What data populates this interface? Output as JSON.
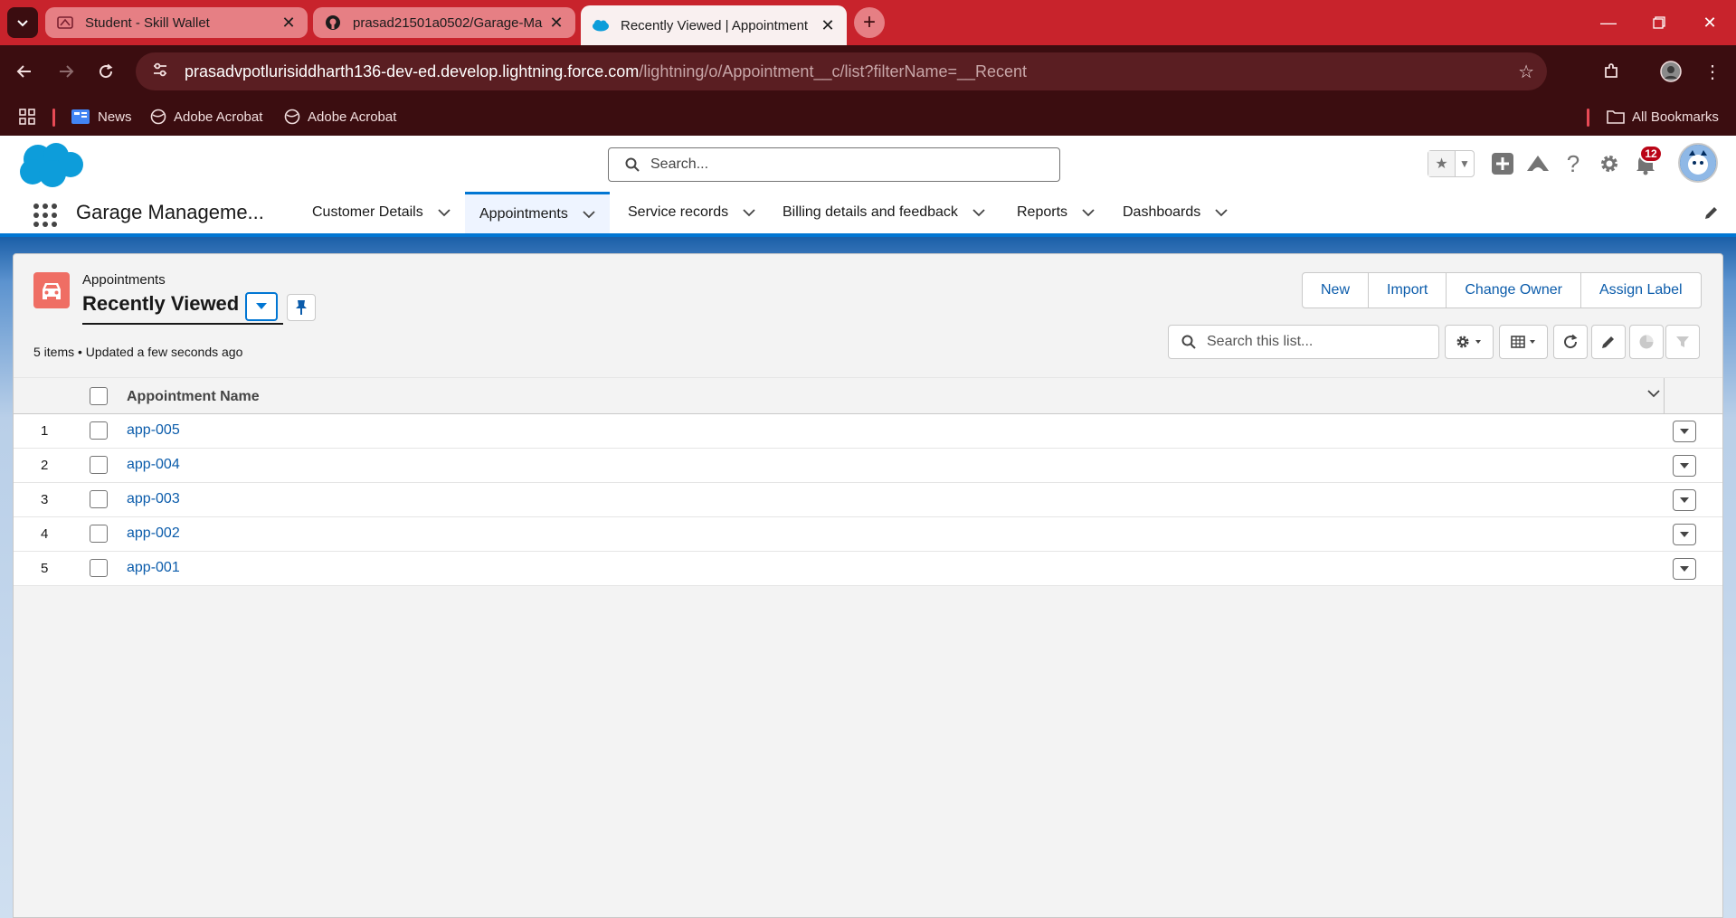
{
  "browser": {
    "tabs": [
      {
        "title": "Student - Skill Wallet",
        "icon": "skill-wallet-icon"
      },
      {
        "title": "prasad21501a0502/Garage-Ma",
        "icon": "github-icon"
      },
      {
        "title": "Recently Viewed | Appointment",
        "icon": "salesforce-cloud-icon",
        "active": true
      }
    ],
    "url_host": "prasadvpotlurisiddharth136-dev-ed.develop.lightning.force.com",
    "url_path": "/lightning/o/Appointment__c/list?filterName=__Recent",
    "bookmarks": [
      {
        "label": "News"
      },
      {
        "label": "Adobe Acrobat"
      },
      {
        "label": "Adobe Acrobat"
      }
    ],
    "all_bookmarks": "All Bookmarks",
    "colors": {
      "tab_strip": "#c8232c",
      "toolbar": "#3b0d10"
    }
  },
  "sf": {
    "search_placeholder": "Search...",
    "notifications_count": "12",
    "app_name": "Garage Manageme...",
    "nav": [
      {
        "label": "Customer Details"
      },
      {
        "label": "Appointments",
        "active": true
      },
      {
        "label": "Service records"
      },
      {
        "label": "Billing details and feedback"
      },
      {
        "label": "Reports"
      },
      {
        "label": "Dashboards"
      }
    ],
    "colors": {
      "brand": "#0176d3",
      "link": "#0b5cab",
      "object_icon": "#ef6e64"
    }
  },
  "list": {
    "object_label": "Appointments",
    "view_name": "Recently Viewed",
    "actions": [
      "New",
      "Import",
      "Change Owner",
      "Assign Label"
    ],
    "meta": "5 items • Updated a few seconds ago",
    "search_placeholder": "Search this list...",
    "column_header": "Appointment Name",
    "rows": [
      {
        "num": "1",
        "name": "app-005"
      },
      {
        "num": "2",
        "name": "app-004"
      },
      {
        "num": "3",
        "name": "app-003"
      },
      {
        "num": "4",
        "name": "app-002"
      },
      {
        "num": "5",
        "name": "app-001"
      }
    ]
  }
}
